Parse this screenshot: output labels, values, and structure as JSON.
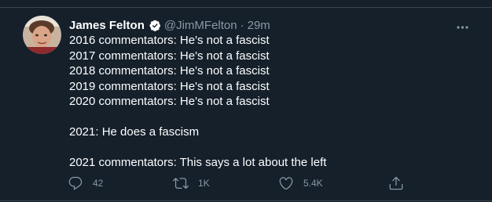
{
  "tweet": {
    "author": {
      "display_name": "James Felton",
      "handle": "@JimMFelton",
      "verified_icon": "verified-badge-icon",
      "avatar_icon": "avatar"
    },
    "separator": "·",
    "timestamp": "29m",
    "more_icon": "more-options-icon",
    "lines": [
      "2016 commentators: He's not a fascist",
      "2017 commentators: He's not a fascist",
      "2018 commentators: He's not a fascist",
      "2019 commentators: He's not a fascist",
      "2020 commentators: He's not a fascist",
      "",
      "2021: He does a fascism",
      "",
      "2021 commentators: This says a lot about the left"
    ],
    "actions": {
      "reply": {
        "icon": "reply-icon",
        "count": "42"
      },
      "retweet": {
        "icon": "retweet-icon",
        "count": "1K"
      },
      "like": {
        "icon": "heart-icon",
        "count": "5.4K"
      },
      "share": {
        "icon": "share-icon"
      }
    }
  },
  "colors": {
    "background": "#15202b",
    "text_primary": "#ffffff",
    "text_secondary": "#8899a6",
    "divider": "#38444d",
    "verified": "#ffffff"
  }
}
